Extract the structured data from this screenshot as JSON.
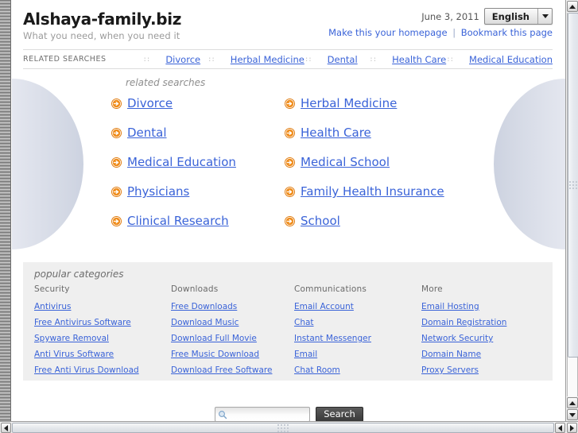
{
  "header": {
    "site_title": "Alshaya-family.biz",
    "tagline": "What you need, when you need it",
    "date": "June 3, 2011",
    "language_selected": "English",
    "homepage_link": "Make this your homepage",
    "link_separator": "|",
    "bookmark_link": "Bookmark this page"
  },
  "nav": {
    "label": "RELATED SEARCHES",
    "separator": "::",
    "items": [
      {
        "label": "Divorce"
      },
      {
        "label": "Herbal Medicine"
      },
      {
        "label": "Dental"
      },
      {
        "label": "Health Care"
      },
      {
        "label": "Medical Education"
      }
    ]
  },
  "main": {
    "heading": "related searches",
    "icon_name": "orange-arrow-circle-icon",
    "icon_color": "#f08c1a",
    "link_color": "#3a63d8",
    "items": [
      {
        "label": "Divorce"
      },
      {
        "label": "Herbal Medicine"
      },
      {
        "label": "Dental"
      },
      {
        "label": "Health Care"
      },
      {
        "label": "Medical Education"
      },
      {
        "label": "Medical School"
      },
      {
        "label": "Physicians"
      },
      {
        "label": "Family Health Insurance"
      },
      {
        "label": "Clinical Research"
      },
      {
        "label": "School"
      }
    ]
  },
  "categories": {
    "heading": "popular categories",
    "columns": [
      {
        "title": "Security",
        "links": [
          "Antivirus",
          "Free Antivirus Software",
          "Spyware Removal",
          "Anti Virus Software",
          "Free Anti Virus Download"
        ]
      },
      {
        "title": "Downloads",
        "links": [
          "Free Downloads",
          "Download Music",
          "Download Full Movie",
          "Free Music Download",
          "Download Free Software"
        ]
      },
      {
        "title": "Communications",
        "links": [
          "Email Account",
          "Chat",
          "Instant Messenger",
          "Email",
          "Chat Room"
        ]
      },
      {
        "title": "More",
        "links": [
          "Email Hosting",
          "Domain Registration",
          "Network Security",
          "Domain Name",
          "Proxy Servers"
        ]
      }
    ]
  },
  "search": {
    "value": "",
    "placeholder": "",
    "button_label": "Search",
    "icon_name": "magnifier-icon"
  },
  "scrollbars": {
    "vertical_name": "vertical-scrollbar",
    "horizontal_name": "horizontal-scrollbar"
  }
}
